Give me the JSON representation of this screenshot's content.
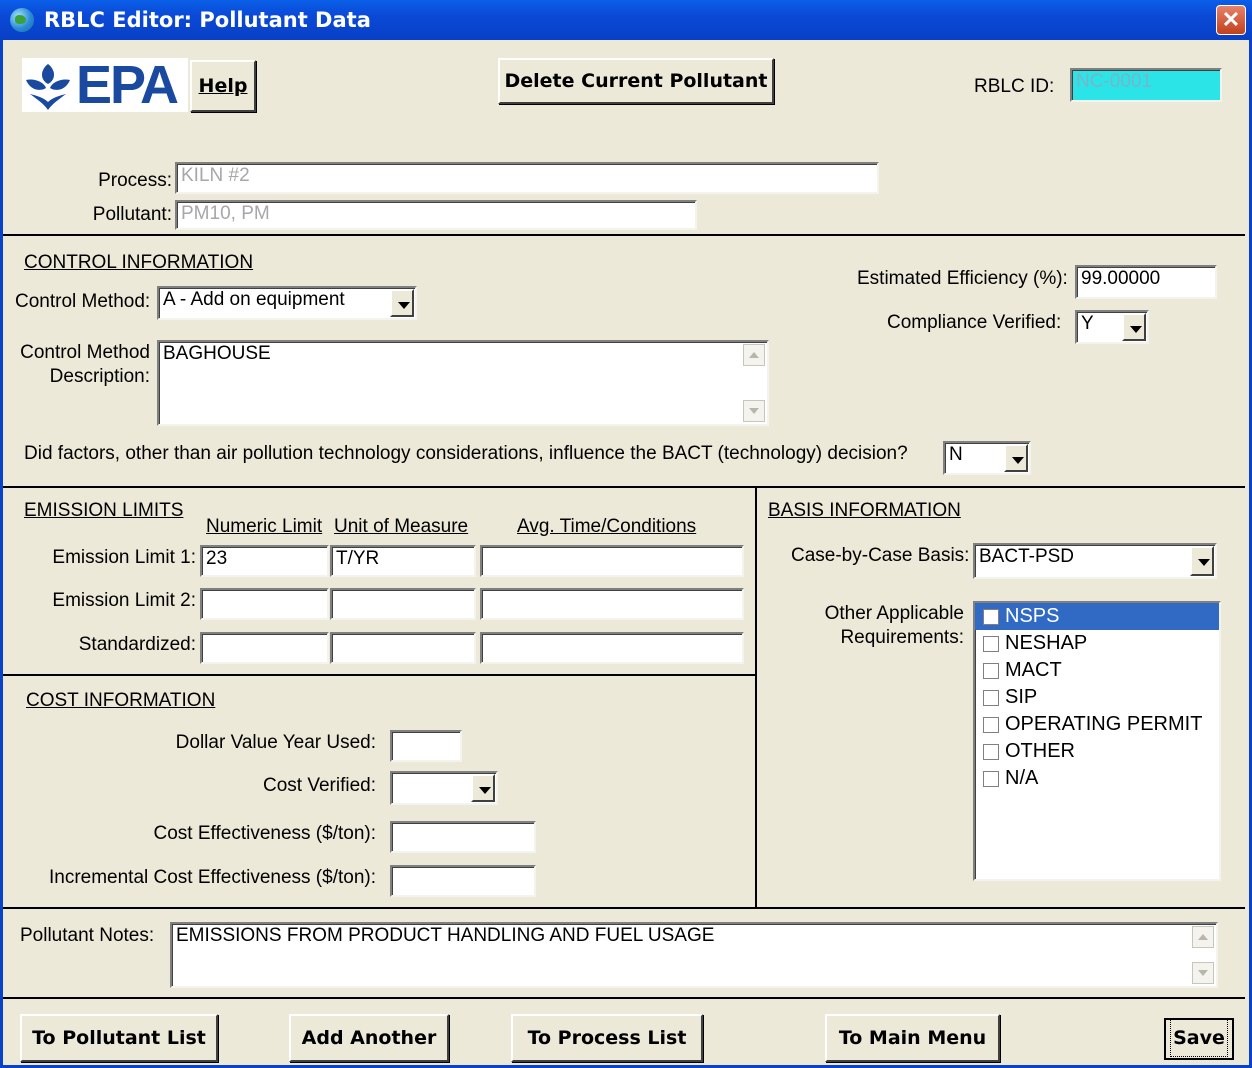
{
  "window": {
    "title": "RBLC Editor:  Pollutant Data",
    "close": "✕"
  },
  "header": {
    "logo_text": "EPA",
    "help_label": "Help",
    "delete_label": "Delete Current Pollutant",
    "rblc_id_label": "RBLC ID:",
    "rblc_id_value": "NC-0001"
  },
  "process": {
    "label": "Process:",
    "value": "KILN #2"
  },
  "pollutant": {
    "label": "Pollutant:",
    "value": "PM10, PM"
  },
  "control": {
    "heading": "CONTROL INFORMATION",
    "method_label": "Control Method:",
    "method_value": "A - Add on equipment",
    "desc_label_1": "Control Method",
    "desc_label_2": "Description:",
    "desc_value": "BAGHOUSE",
    "efficiency_label": "Estimated Efficiency (%):",
    "efficiency_value": "99.00000",
    "compliance_label": "Compliance Verified:",
    "compliance_value": "Y",
    "factors_question": "Did factors, other than air pollution technology considerations, influence the BACT (technology) decision?",
    "factors_value": "N"
  },
  "emission": {
    "heading": "EMISSION LIMITS",
    "columns": [
      "Numeric Limit",
      "Unit of Measure",
      "Avg. Time/Conditions"
    ],
    "rows": [
      {
        "label": "Emission Limit 1:",
        "numeric": "23",
        "unit": "T/YR",
        "avg": ""
      },
      {
        "label": "Emission Limit 2:",
        "numeric": "",
        "unit": "",
        "avg": ""
      },
      {
        "label": "Standardized:",
        "numeric": "",
        "unit": "",
        "avg": ""
      }
    ]
  },
  "cost": {
    "heading": "COST INFORMATION",
    "dollar_year_label": "Dollar Value Year Used:",
    "dollar_year_value": "",
    "verified_label": "Cost Verified:",
    "verified_value": "",
    "effectiveness_label": "Cost Effectiveness ($/ton):",
    "effectiveness_value": "",
    "incremental_label": "Incremental Cost Effectiveness ($/ton):",
    "incremental_value": ""
  },
  "basis": {
    "heading": "BASIS INFORMATION",
    "case_label": "Case-by-Case Basis:",
    "case_value": "BACT-PSD",
    "other_label_1": "Other Applicable",
    "other_label_2": "Requirements:",
    "requirements": [
      "NSPS",
      "NESHAP",
      "MACT",
      "SIP",
      "OPERATING PERMIT",
      "OTHER",
      "N/A"
    ],
    "selected_requirement": "NSPS"
  },
  "notes": {
    "label": "Pollutant Notes:",
    "value": "EMISSIONS FROM PRODUCT HANDLING AND FUEL USAGE"
  },
  "footer": {
    "pollutant_list": "To Pollutant List",
    "add_another": "Add Another",
    "process_list": "To Process List",
    "main_menu": "To Main Menu",
    "save": "Save"
  }
}
